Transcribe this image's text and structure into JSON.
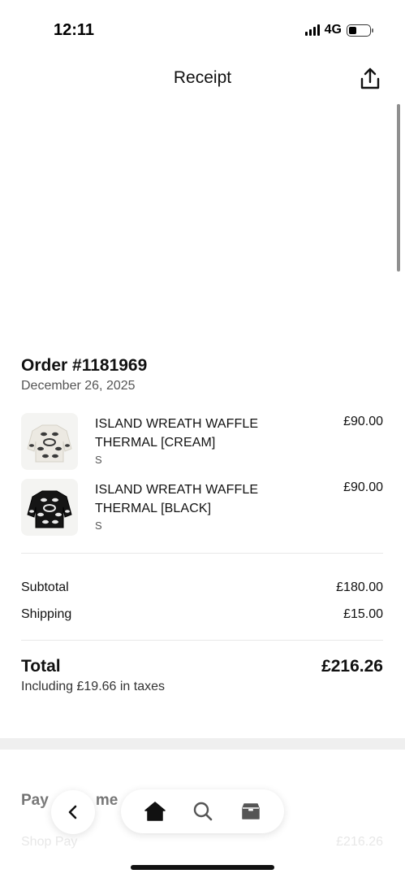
{
  "status_bar": {
    "time": "12:11",
    "network": "4G"
  },
  "header": {
    "title": "Receipt",
    "share_icon": "share-icon"
  },
  "order": {
    "number": "Order #1181969",
    "date": "December 26, 2025",
    "items": [
      {
        "name": "ISLAND WREATH WAFFLE THERMAL [CREAM]",
        "variant": "S",
        "price": "£90.00",
        "color": "#ece9e2"
      },
      {
        "name": "ISLAND WREATH WAFFLE THERMAL [BLACK]",
        "variant": "S",
        "price": "£90.00",
        "color": "#151515"
      }
    ]
  },
  "summary": {
    "subtotal_label": "Subtotal",
    "subtotal_value": "£180.00",
    "shipping_label": "Shipping",
    "shipping_value": "£15.00",
    "total_label": "Total",
    "total_value": "£216.26",
    "tax_note": "Including £19.66 in taxes"
  },
  "payment": {
    "title_visible_left": "Pay",
    "title_visible_right": "me",
    "method": "Shop Pay",
    "amount": "£216.26"
  },
  "bottom_nav": {
    "back_icon": "chevron-left-icon",
    "tabs": [
      "home-icon",
      "search-icon",
      "orders-box-icon"
    ]
  }
}
